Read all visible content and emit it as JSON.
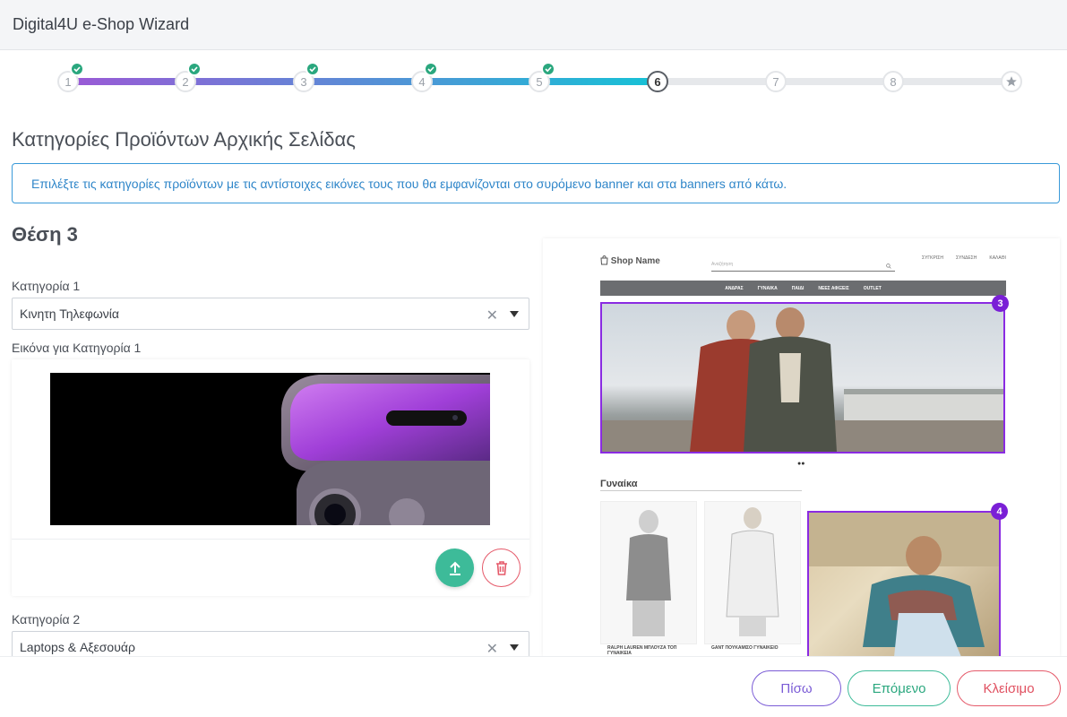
{
  "window": {
    "title": "Digital4U e-Shop Wizard"
  },
  "stepper": {
    "steps": [
      {
        "label": "1",
        "done": true
      },
      {
        "label": "2",
        "done": true
      },
      {
        "label": "3",
        "done": true
      },
      {
        "label": "4",
        "done": true
      },
      {
        "label": "5",
        "done": true
      },
      {
        "label": "6",
        "done": false
      },
      {
        "label": "7",
        "done": false
      },
      {
        "label": "8",
        "done": false
      }
    ],
    "current": "6",
    "final_icon": "star-icon",
    "colors": {
      "done_start": "#9b59d6",
      "done_end": "#16c2d6",
      "pending": "#e6e8eb",
      "check": "#2aa77e"
    }
  },
  "page": {
    "title": "Κατηγορίες Προϊόντων Αρχικής Σελίδας",
    "info": "Επιλέξτε τις κατηγορίες προϊόντων με τις αντίστοιχες εικόνες τους που θα εμφανίζονται στο συρόμενο banner και στα banners από κάτω.",
    "section": "Θέση 3"
  },
  "form": {
    "category1_label": "Κατηγορία 1",
    "category1_value": "Κινητη Τηλεφωνία",
    "image1_label": "Εικόνα για Κατηγορία 1",
    "category2_label": "Κατηγορία 2",
    "category2_value": "Laptops & Αξεσουάρ",
    "clear_glyph": "✕"
  },
  "preview": {
    "logo": "Shop Name",
    "search_placeholder": "Αναζήτηση",
    "icons": [
      "ΣΥΓΚΡΙΣΗ",
      "ΣΥΝΔΕΣΗ",
      "ΚΑΛΑΘΙ"
    ],
    "nav": [
      "ΑΝΔΡΑΣ",
      "ΓΥΝΑΙΚΑ",
      "ΠΑΙΔΙ",
      "ΝΕΕΣ ΑΦΙΞΕΙΣ",
      "OUTLET"
    ],
    "hero_badge": "3",
    "promo_badge": "4",
    "dots": "●●",
    "section": "Γυναίκα",
    "products": [
      "RALPH LAUREN ΜΠΛΟΥΖΑ ΤΟΠ ΓΥΝΑΙΚΕΙΑ",
      "GANT ΠΟΥΚΑΜΙΣΟ ΓΥΝΑΙΚΕΙΟ"
    ],
    "highlight_color": "#8a2be2"
  },
  "footer": {
    "back": "Πίσω",
    "next": "Επόμενο",
    "close": "Κλείσιμο",
    "colors": {
      "back": "#7b5cd6",
      "next": "#3dbb99",
      "close": "#e55a6a"
    }
  }
}
